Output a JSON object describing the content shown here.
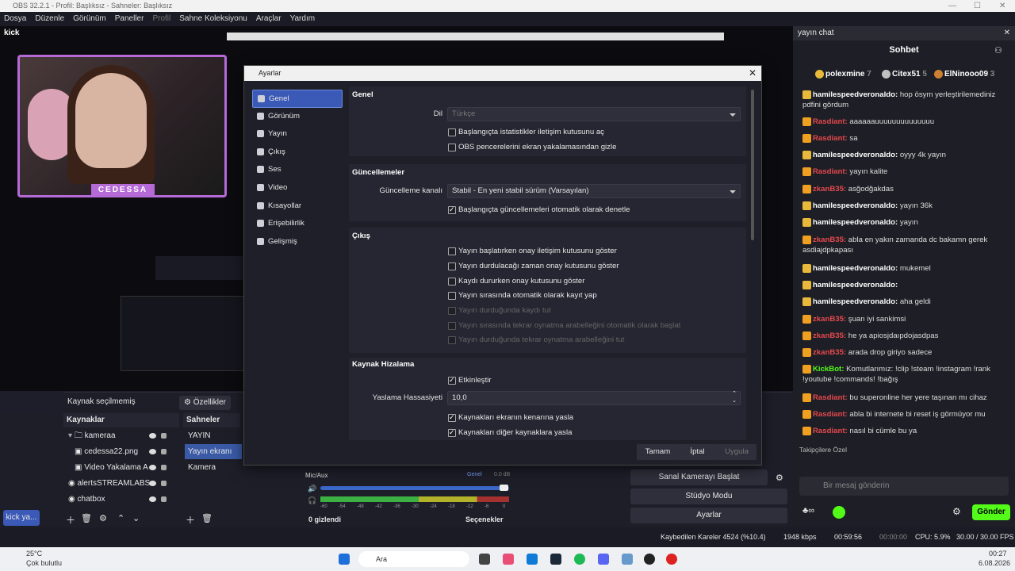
{
  "window": {
    "title": "OBS 32.2.1 - Profil: Başlıksız - Sahneler: Başlıksız"
  },
  "menu": [
    "Dosya",
    "Düzenle",
    "Görünüm",
    "Paneller",
    "Profil",
    "Sahne Koleksiyonu",
    "Araçlar",
    "Yardım"
  ],
  "preview": {
    "cam_tag": "CEDESSA",
    "kick_label": "kick"
  },
  "sourcebar": {
    "no_source": "Kaynak seçilmemiş",
    "properties": "Özellikler"
  },
  "sources": {
    "title": "Kaynaklar",
    "items": [
      "kameraa",
      "cedessa22.png",
      "Video Yakalama A",
      "alertsSTREAMLABS",
      "chatbox"
    ]
  },
  "scenes": {
    "title": "Sahneler",
    "items": [
      "YAYIN BAŞLIYOR",
      "Yayın ekranı",
      "Kamera"
    ]
  },
  "mixer": {
    "label": "Mic/Aux",
    "level": "0.0 dB",
    "device": "Genel",
    "hidden": "0 gizlendi",
    "options": "Seçenekler",
    "ticks": [
      "-60",
      "-54",
      "-48",
      "-42",
      "-36",
      "-30",
      "-24",
      "-18",
      "-12",
      "-6",
      "0"
    ]
  },
  "controls": [
    "Sanal Kamerayı Başlat",
    "Stüdyo Modu",
    "Ayarlar"
  ],
  "taskbar_tab": "kick ya...",
  "status": {
    "dropped": "Kaybedilen Kareler 4524 (%10.4)",
    "bitrate": "1948 kbps",
    "live": "00:59:56",
    "rec": "00:00:00",
    "cpu": "CPU: 5.9%",
    "fps": "30.00 / 30.00 FPS"
  },
  "taskbar": {
    "temp": "25°C",
    "weather": "Çok bulutlu",
    "search": "Ara",
    "time": "00:27",
    "date": "6.08.2026"
  },
  "dialog": {
    "title": "Ayarlar",
    "nav": [
      "Genel",
      "Görünüm",
      "Yayın",
      "Çıkış",
      "Ses",
      "Video",
      "Kısayollar",
      "Erişebilirlik",
      "Gelişmiş"
    ],
    "general": {
      "title": "Genel",
      "lang_label": "Dil",
      "lang_value": "Türkçe",
      "chk1": "Başlangıçta istatistikler iletişim kutusunu aç",
      "chk2": "OBS pencerelerini ekran yakalamasından gizle"
    },
    "updates": {
      "title": "Güncellemeler",
      "channel_label": "Güncelleme kanalı",
      "channel_value": "Stabil - En yeni stabil sürüm (Varsayılan)",
      "chk": "Başlangıçta güncellemeleri otomatik olarak denetle"
    },
    "output": {
      "title": "Çıkış",
      "items": [
        "Yayın başlatırken onay iletişim kutusunu göster",
        "Yayın durdulacağı zaman onay kutusunu göster",
        "Kaydı dururken onay kutusunu göster",
        "Yayın sırasında otomatik olarak kayıt yap",
        "Yayın durduğunda kaydı tut",
        "Yayın sırasında tekrar oynatma arabelleğini otomatik olarak başlat",
        "Yayın durduğunda tekrar oynatma arabelleğini tut"
      ]
    },
    "snap": {
      "title": "Kaynak Hizalama",
      "enable": "Etkinleştir",
      "sens_label": "Yaslama Hassasiyeti",
      "sens_value": "10,0",
      "chk1": "Kaynakları ekranın kenarına yasla",
      "chk2": "Kaynakları diğer kaynaklara yasla"
    },
    "buttons": {
      "ok": "Tamam",
      "cancel": "İptal",
      "apply": "Uygula"
    }
  },
  "chat": {
    "header": "yayın chat",
    "tab": "Sohbet",
    "leaders": [
      {
        "name": "polexmine",
        "count": "7"
      },
      {
        "name": "Citex51",
        "count": "5"
      },
      {
        "name": "ElNinooo09",
        "count": "3"
      }
    ],
    "messages": [
      {
        "user": "hamilespeedveronaldo:",
        "text": "hop ösym yerleştirilemediniz pdfini gördum",
        "color": "#ffffff"
      },
      {
        "user": "Rasdiant:",
        "text": "aaaaaauuuuuuuuuuuuuu",
        "color": "#e5484d"
      },
      {
        "user": "Rasdiant:",
        "text": "sa",
        "color": "#e5484d"
      },
      {
        "user": "hamilespeedveronaldo:",
        "text": "oyyy 4k yayın",
        "color": "#ffffff"
      },
      {
        "user": "Rasdiant:",
        "text": "yayın kalite",
        "color": "#e5484d"
      },
      {
        "user": "zkanB35:",
        "text": "asğodğakdas",
        "color": "#e5484d"
      },
      {
        "user": "hamilespeedveronaldo:",
        "text": "yayın 36k",
        "color": "#ffffff"
      },
      {
        "user": "hamilespeedveronaldo:",
        "text": "yayın",
        "color": "#ffffff"
      },
      {
        "user": "zkanB35:",
        "text": "abla en yakın zamanda dc bakamn gerek asdiajdpkapası",
        "color": "#e5484d"
      },
      {
        "user": "hamilespeedveronaldo:",
        "text": "mukemel",
        "color": "#ffffff"
      },
      {
        "user": "hamilespeedveronaldo:",
        "text": "",
        "color": "#ffffff"
      },
      {
        "user": "hamilespeedveronaldo:",
        "text": "aha geldi",
        "color": "#ffffff"
      },
      {
        "user": "zkanB35:",
        "text": "şuan iyi sankimsi",
        "color": "#e5484d"
      },
      {
        "user": "zkanB35:",
        "text": "he ya apiosjdaıpdojasdpas",
        "color": "#e5484d"
      },
      {
        "user": "zkanB35:",
        "text": "arada drop giriyo sadece",
        "color": "#e5484d"
      },
      {
        "user": "KickBot:",
        "text": "Komutlarımız: !clip !steam !instagram !rank !youtube !commands! !bağış",
        "color": "#53fc18"
      },
      {
        "user": "Rasdiant:",
        "text": "bu superonline her yere taşınan mı cihaz",
        "color": "#e5484d"
      },
      {
        "user": "Rasdiant:",
        "text": "abla bi internete bi reset iş görmüyor mu",
        "color": "#e5484d"
      },
      {
        "user": "Rasdiant:",
        "text": "nasıl bi cümle bu ya",
        "color": "#e5484d"
      }
    ],
    "special_label": "Takipçilere Özel",
    "input_placeholder": "Bir mesaj gönderin",
    "send": "Gönder"
  }
}
